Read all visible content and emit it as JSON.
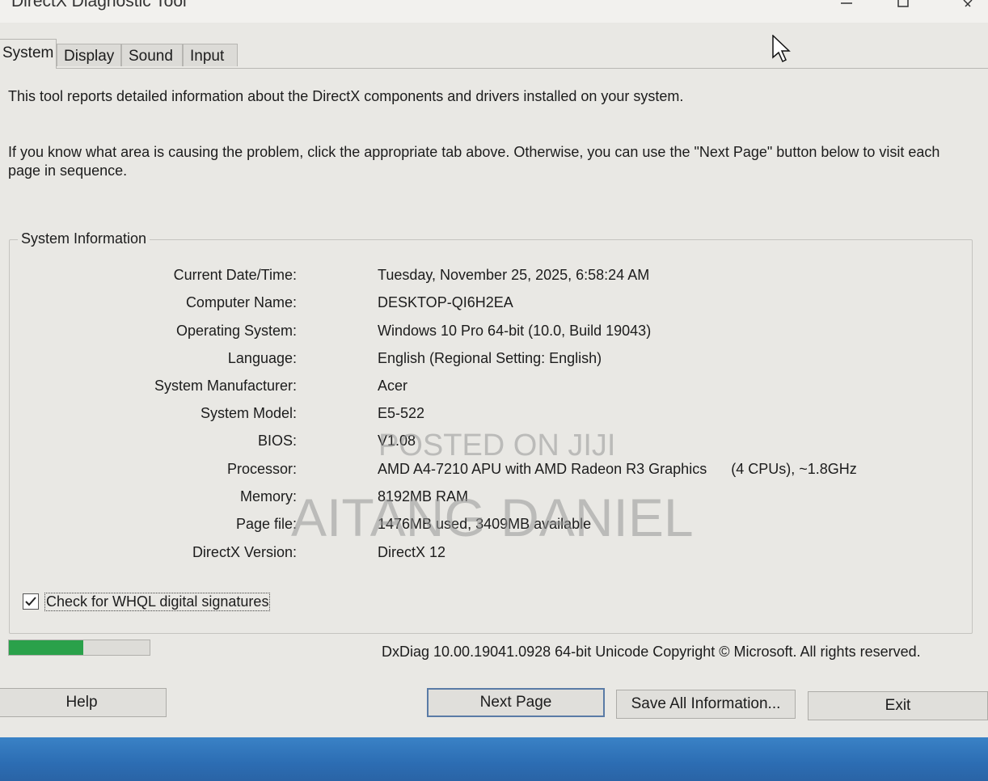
{
  "window": {
    "title": "DirectX Diagnostic Tool"
  },
  "tabs": [
    {
      "label": "System",
      "active": true
    },
    {
      "label": "Display",
      "active": false
    },
    {
      "label": "Sound",
      "active": false
    },
    {
      "label": "Input",
      "active": false
    }
  ],
  "intro": {
    "line1": "This tool reports detailed information about the DirectX components and drivers installed on your system.",
    "line2": "If you know what area is causing the problem, click the appropriate tab above.  Otherwise, you can use the \"Next Page\" button below to visit each page in sequence."
  },
  "system_info": {
    "group_title": "System Information",
    "rows": [
      {
        "label": "Current Date/Time:",
        "value": "Tuesday, November 25, 2025, 6:58:24 AM"
      },
      {
        "label": "Computer Name:",
        "value": "DESKTOP-QI6H2EA"
      },
      {
        "label": "Operating System:",
        "value": "Windows 10 Pro 64-bit (10.0, Build 19043)"
      },
      {
        "label": "Language:",
        "value": "English (Regional Setting: English)"
      },
      {
        "label": "System Manufacturer:",
        "value": "Acer"
      },
      {
        "label": "System Model:",
        "value": "E5-522"
      },
      {
        "label": "BIOS:",
        "value": "V1.08"
      },
      {
        "label": "Processor:",
        "value": "AMD A4-7210 APU with AMD Radeon R3 Graphics      (4 CPUs), ~1.8GHz"
      },
      {
        "label": "Memory:",
        "value": "8192MB RAM"
      },
      {
        "label": "Page file:",
        "value": "1476MB used, 3409MB available"
      },
      {
        "label": "DirectX Version:",
        "value": "DirectX 12"
      }
    ]
  },
  "whql_checkbox": {
    "label": "Check for WHQL digital signatures",
    "checked": true
  },
  "progress": {
    "fraction": 0.53,
    "color": "#2aa14a"
  },
  "copyright": "DxDiag 10.00.19041.0928 64-bit Unicode  Copyright © Microsoft. All rights reserved.",
  "buttons": {
    "help": "Help",
    "next_page": "Next Page",
    "save_all": "Save All Information...",
    "exit": "Exit"
  },
  "watermark": {
    "line1": "POSTED ON JIJI",
    "line2": "AITANG DANIEL"
  },
  "colors": {
    "window_bg": "#e9e8e4",
    "taskbar": "#2c6db3",
    "default_button_border": "#5a7ba6"
  }
}
